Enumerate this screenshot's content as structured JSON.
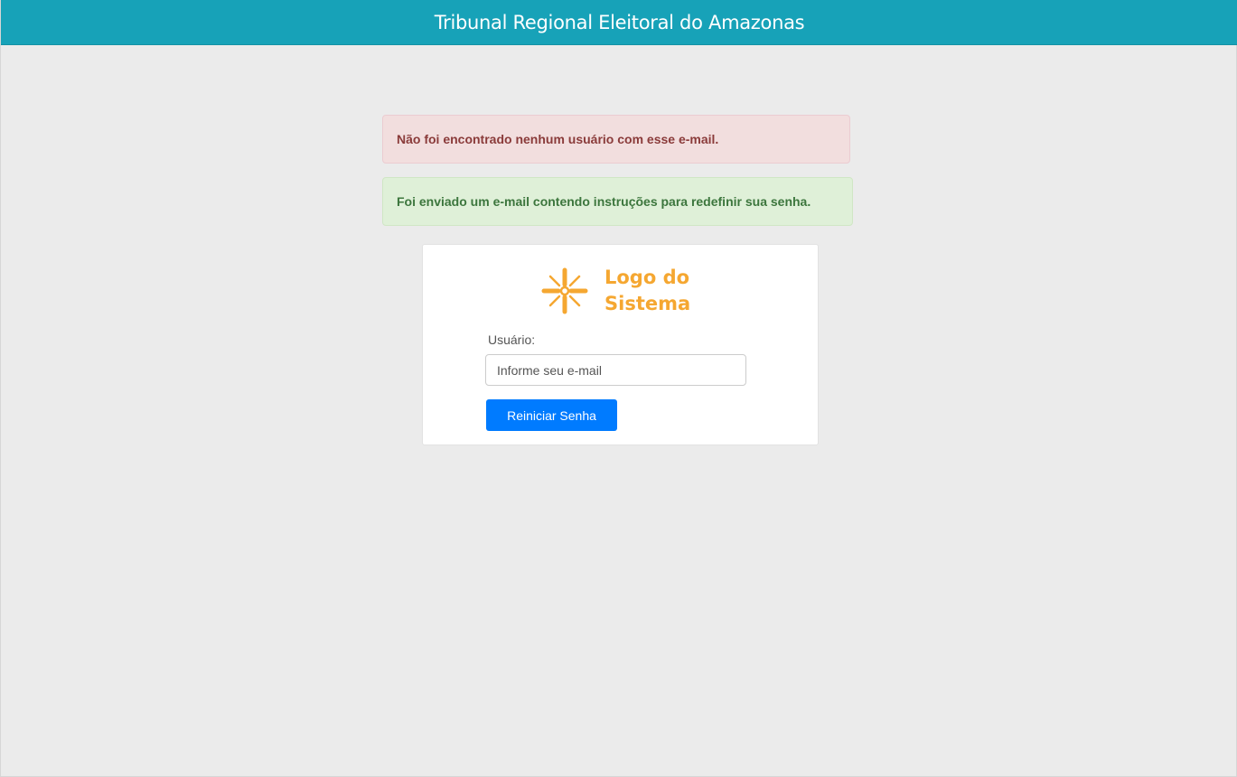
{
  "header": {
    "title": "Tribunal Regional Eleitoral do Amazonas",
    "background_color": "#17a2b8"
  },
  "alerts": {
    "error_message": "Não foi encontrado nenhum usuário com esse e-mail.",
    "success_message": "Foi enviado um e-mail contendo instruções para redefinir sua senha."
  },
  "login_card": {
    "logo": {
      "icon": "sun-burst-icon",
      "text_line1": "Logo do",
      "text_line2": "Sistema",
      "color": "#f5a731"
    },
    "user_label": "Usuário:",
    "email_placeholder": "Informe seu e-mail",
    "email_value": "",
    "submit_label": "Reiniciar Senha",
    "submit_color": "#007bff"
  }
}
